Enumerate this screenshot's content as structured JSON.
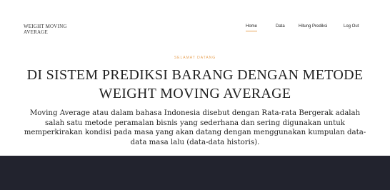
{
  "navbar": {
    "brand": "WEIGHT MOVING\nAVERAGE",
    "items": [
      {
        "label": "Home",
        "active": true
      },
      {
        "label": "Data",
        "active": false
      },
      {
        "label": "Hitung Prediksi",
        "active": false
      },
      {
        "label": "Log Out",
        "active": false
      }
    ],
    "accent_color": "#e8a45a"
  },
  "hero": {
    "greeting": "SELAMAT DATANG",
    "title": "DI SISTEM PREDIKSI BARANG DENGAN METODE WEIGHT MOVING AVERAGE",
    "description": "Moving Average atau dalam bahasa Indonesia disebut dengan Rata-rata Bergerak adalah salah satu metode peramalan bisnis yang sederhana dan sering digunakan untuk memperkirakan kondisi pada masa yang akan datang dengan menggunakan kumpulan data-data masa lalu (data-data historis)."
  },
  "footer_band": {
    "color": "#22232e"
  }
}
